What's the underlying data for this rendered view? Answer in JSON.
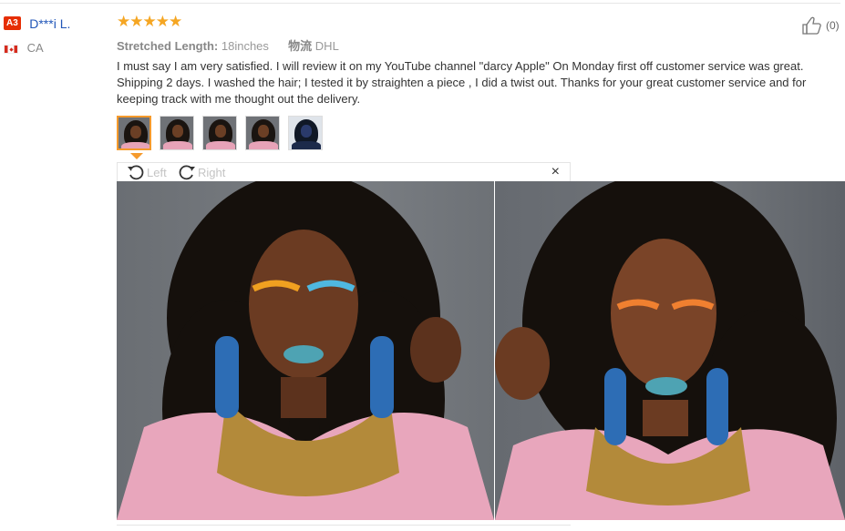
{
  "user": {
    "badge": "A3",
    "name": "D***i L.",
    "country": "CA",
    "flag_icon": "canada-flag-icon"
  },
  "review": {
    "stars": "★★★★★",
    "rating": 5,
    "meta_label": "Stretched Length:",
    "meta_value": "18inches",
    "shipping_label": "物流",
    "shipping_value": "DHL",
    "text": "I must say I am very satisfied. I will review it on my YouTube channel \"darcy Apple\" On Monday first off customer service was great. Shipping 2 days. I washed the hair; I tested it by straighten a piece , I did a twist out. Thanks for your great customer service and for keeping track with me thought out the delivery."
  },
  "helpful": {
    "count": "(0)",
    "icon": "thumbs-up-icon"
  },
  "viewer": {
    "rotate_left": "Left",
    "rotate_right": "Right",
    "close": "×"
  },
  "colors": {
    "accent": "#f59a2c",
    "link": "#2156b8",
    "badge": "#e62e04",
    "star": "#f5a623"
  }
}
